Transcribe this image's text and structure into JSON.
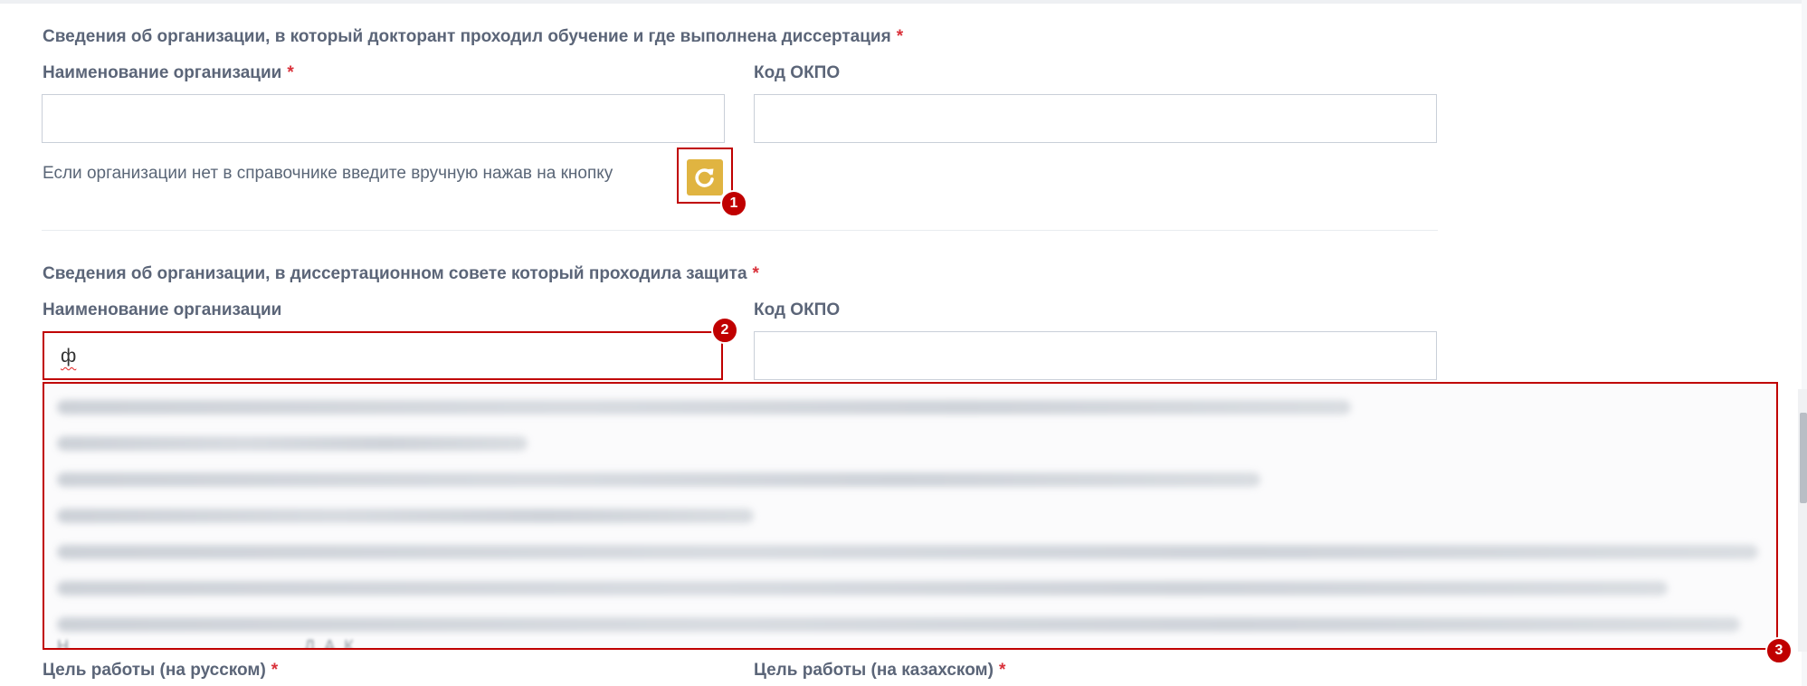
{
  "section1": {
    "title": "Сведения об организации, в который докторант проходил обучение и где выполнена диссертация",
    "org_name_label": "Наименование организации",
    "okpo_label": "Код ОКПО",
    "org_name_value": "",
    "okpo_value": "",
    "hint": "Если организации нет в справочнике введите вручную нажав на кнопку",
    "manual_button_icon": "refresh-icon"
  },
  "section2": {
    "title": "Сведения об организации, в диссертационном совете который проходила защита",
    "org_name_label": "Наименование организации",
    "okpo_label": "Код ОКПО",
    "org_name_value": "ф",
    "okpo_value": ""
  },
  "section3": {
    "goal_ru_label": "Цель работы (на русском)",
    "goal_kz_label": "Цель работы (на казахском)"
  },
  "required_mark": "*",
  "annotations": [
    "1",
    "2",
    "3"
  ],
  "dropdown": {
    "partial_text": "Н                                                    Д. А. К"
  },
  "colors": {
    "label": "#5b6578",
    "required": "#d9313a",
    "button": "#e0b441",
    "annotation": "#c00000"
  }
}
